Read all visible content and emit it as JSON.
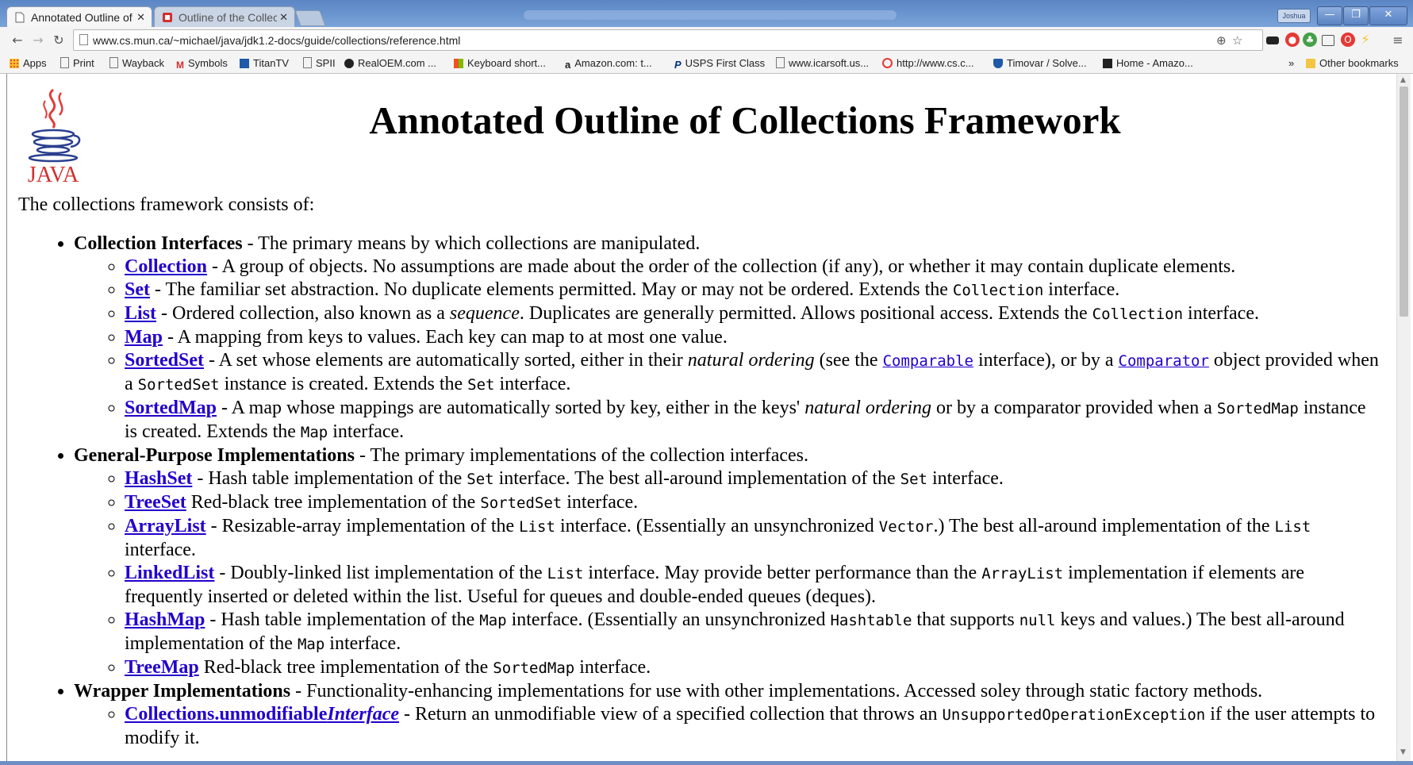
{
  "browser": {
    "tabs": [
      {
        "title": "Annotated Outline of",
        "active": true
      },
      {
        "title": "Outline of the Collect",
        "active": false
      }
    ],
    "profile": "Joshua",
    "url": "www.cs.mun.ca/~michael/java/jdk1.2-docs/guide/collections/reference.html",
    "bookmarks": [
      {
        "label": "Apps",
        "icon": "apps-grid-icon"
      },
      {
        "label": "Print",
        "icon": "page-icon"
      },
      {
        "label": "Wayback",
        "icon": "page-icon"
      },
      {
        "label": "Symbols",
        "icon": "gmail-icon"
      },
      {
        "label": "TitanTV",
        "icon": "titantv-icon"
      },
      {
        "label": "SPII",
        "icon": "page-icon"
      },
      {
        "label": "RealOEM.com ...",
        "icon": "globe-icon"
      },
      {
        "label": "Keyboard short...",
        "icon": "windows-icon"
      },
      {
        "label": "Amazon.com: t...",
        "icon": "amazon-icon"
      },
      {
        "label": "USPS First Class",
        "icon": "paypal-icon"
      },
      {
        "label": "www.icarsoft.us...",
        "icon": "page-icon"
      },
      {
        "label": "http://www.cs.c...",
        "icon": "target-icon"
      },
      {
        "label": "Timovar / Solve...",
        "icon": "shield-icon"
      },
      {
        "label": "Home - Amazo...",
        "icon": "amazon-dark-icon"
      }
    ],
    "overflow": "»",
    "other_bookmarks": "Other bookmarks"
  },
  "page": {
    "title": "Annotated Outline of Collections Framework",
    "logo_text": "JAVA",
    "intro": "The collections framework consists of:",
    "sections": [
      {
        "heading": "Collection Interfaces",
        "desc": " - The primary means by which collections are manipulated.",
        "items": [
          {
            "name": "Collection",
            "text": " - A group of objects. No assumptions are made about the order of the collection (if any), or whether it may contain duplicate elements."
          },
          {
            "name": "Set",
            "text": " - The familiar set abstraction. No duplicate elements permitted. May or may not be ordered. Extends the ",
            "code": "Collection",
            "after": " interface."
          },
          {
            "name": "List",
            "text": " - Ordered collection, also known as a ",
            "em": "sequence",
            "text2": ". Duplicates are generally permitted. Allows positional access. Extends the ",
            "code": "Collection",
            "after": " interface."
          },
          {
            "name": "Map",
            "text": " - A mapping from keys to values. Each key can map to at most one value."
          },
          {
            "name": "SortedSet",
            "text": " - A set whose elements are automatically sorted, either in their ",
            "em": "natural ordering",
            "text2": " (see the ",
            "link1": "Comparable",
            "text3": " interface), or by a ",
            "link2": "Comparator",
            "text4": " object provided when a ",
            "code": "SortedSet",
            "text5": " instance is created. Extends the ",
            "code2": "Set",
            "after": " interface."
          },
          {
            "name": "SortedMap",
            "text": " - A map whose mappings are automatically sorted by key, either in the keys' ",
            "em": "natural ordering",
            "text2": " or by a comparator provided when a ",
            "code": "SortedMap",
            "text3": " instance is created. Extends the ",
            "code2": "Map",
            "after": " interface."
          }
        ]
      },
      {
        "heading": "General-Purpose Implementations",
        "desc": " - The primary implementations of the collection interfaces.",
        "items": [
          {
            "name": "HashSet",
            "text": " - Hash table implementation of the ",
            "code": "Set",
            "text2": " interface. The best all-around implementation of the ",
            "code2": "Set",
            "after": " interface."
          },
          {
            "name": "TreeSet",
            "text": " Red-black tree implementation of the ",
            "code": "SortedSet",
            "after": " interface."
          },
          {
            "name": "ArrayList",
            "text": " - Resizable-array implementation of the ",
            "code": "List",
            "text2": " interface. (Essentially an unsynchronized ",
            "code2": "Vector",
            "text3": ".) The best all-around implementation of the ",
            "code3": "List",
            "after": " interface."
          },
          {
            "name": "LinkedList",
            "text": " - Doubly-linked list implementation of the ",
            "code": "List",
            "text2": " interface. May provide better performance than the ",
            "code2": "ArrayList",
            "after": " implementation if elements are frequently inserted or deleted within the list. Useful for queues and double-ended queues (deques)."
          },
          {
            "name": "HashMap",
            "text": " - Hash table implementation of the ",
            "code": "Map",
            "text2": " interface. (Essentially an unsynchronized ",
            "code2": "Hashtable",
            "text3": " that supports ",
            "code3": "null",
            "text4": " keys and values.) The best all-around implementation of the ",
            "code4": "Map",
            "after": " interface."
          },
          {
            "name": "TreeMap",
            "text": " Red-black tree implementation of the ",
            "code": "SortedMap",
            "after": " interface."
          }
        ]
      },
      {
        "heading": "Wrapper Implementations",
        "desc": " - Functionality-enhancing implementations for use with other implementations. Accessed soley through static factory methods.",
        "items": [
          {
            "name": "Collections.unmodifiable",
            "name_em": "Interface",
            "text": " - Return an unmodifiable view of a specified collection that throws an ",
            "code": "UnsupportedOperationException",
            "after": " if the user attempts to modify it."
          }
        ]
      }
    ]
  },
  "colors": {
    "link": "#2200cc",
    "titlebar": "#6d97d0"
  }
}
